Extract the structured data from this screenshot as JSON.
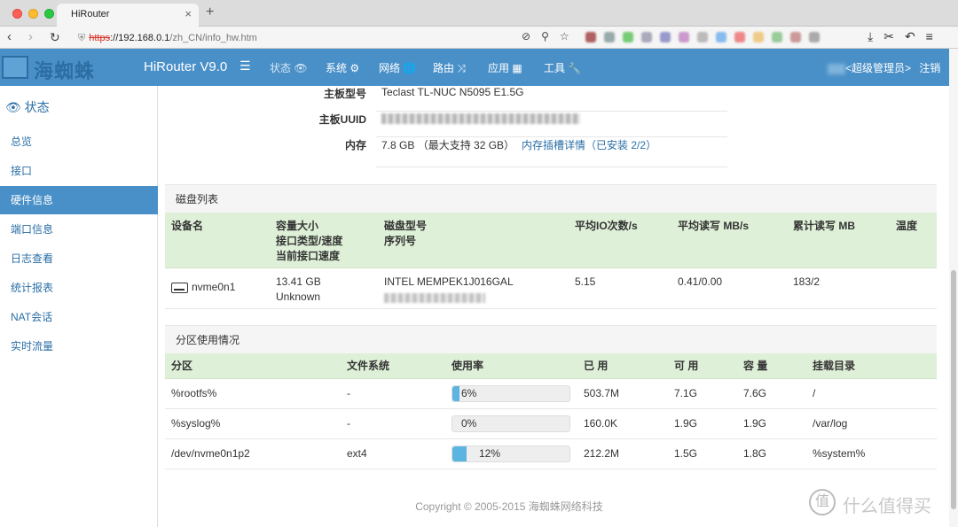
{
  "browser": {
    "tab_title": "HiRouter",
    "tab_close": "×",
    "new_tab": "+",
    "url_scheme": "https",
    "url_host": "://192.168.0.1",
    "url_path": "/zh_CN/info_hw.htm"
  },
  "header": {
    "logo_text": "海蜘蛛",
    "brand": "HiRouter V9.0",
    "nav": [
      {
        "label": "状态 👁"
      },
      {
        "label": "系统 ⚙"
      },
      {
        "label": "网络 🌐"
      },
      {
        "label": "路由 ⤨"
      },
      {
        "label": "应用 ▦"
      },
      {
        "label": "工具 🔧"
      }
    ],
    "user_role": "<超级管理员>",
    "logout": "注销"
  },
  "sidebar": {
    "title": "状态",
    "items": [
      {
        "label": "总览"
      },
      {
        "label": "接口"
      },
      {
        "label": "硬件信息"
      },
      {
        "label": "端口信息"
      },
      {
        "label": "日志查看"
      },
      {
        "label": "统计报表"
      },
      {
        "label": "NAT会话"
      },
      {
        "label": "实时流量"
      }
    ]
  },
  "info": {
    "board_model_label": "主板型号",
    "board_model_value": "Teclast TL-NUC N5095 E1.5G",
    "board_uuid_label": "主板UUID",
    "memory_label": "内存",
    "memory_value": "7.8 GB （最大支持 32 GB）",
    "memory_link": "内存插槽详情（已安装 2/2）"
  },
  "disk": {
    "title": "磁盘列表",
    "headers": {
      "device": "设备名",
      "capacity": "容量大小",
      "iface_type": "接口类型/速度",
      "iface_current": "当前接口速度",
      "model": "磁盘型号",
      "serial": "序列号",
      "iops": "平均IO次数/s",
      "rw": "平均读写 MB/s",
      "total_rw": "累计读写 MB",
      "temp": "温度"
    },
    "row": {
      "device": "nvme0n1",
      "capacity": "13.41 GB",
      "iface": "Unknown",
      "model": "INTEL MEMPEK1J016GAL",
      "iops": "5.15",
      "rw": "0.41/0.00",
      "total_rw": "183/2"
    }
  },
  "partitions": {
    "title": "分区使用情况",
    "headers": {
      "partition": "分区",
      "fs": "文件系统",
      "usage": "使用率",
      "used": "已 用",
      "free": "可 用",
      "capacity": "容 量",
      "mount": "挂载目录"
    },
    "rows": [
      {
        "partition": "%rootfs%",
        "fs": "-",
        "usage": "6%",
        "usage_pct": 6,
        "used": "503.7M",
        "free": "7.1G",
        "capacity": "7.6G",
        "mount": "/"
      },
      {
        "partition": "%syslog%",
        "fs": "-",
        "usage": "0%",
        "usage_pct": 0,
        "used": "160.0K",
        "free": "1.9G",
        "capacity": "1.9G",
        "mount": "/var/log"
      },
      {
        "partition": "/dev/nvme0n1p2",
        "fs": "ext4",
        "usage": "12%",
        "usage_pct": 12,
        "used": "212.2M",
        "free": "1.5G",
        "capacity": "1.8G",
        "mount": "%system%"
      }
    ]
  },
  "footer": "Copyright © 2005-2015 海蜘蛛网络科技",
  "watermark": {
    "icon": "值",
    "text": "什么值得买"
  }
}
